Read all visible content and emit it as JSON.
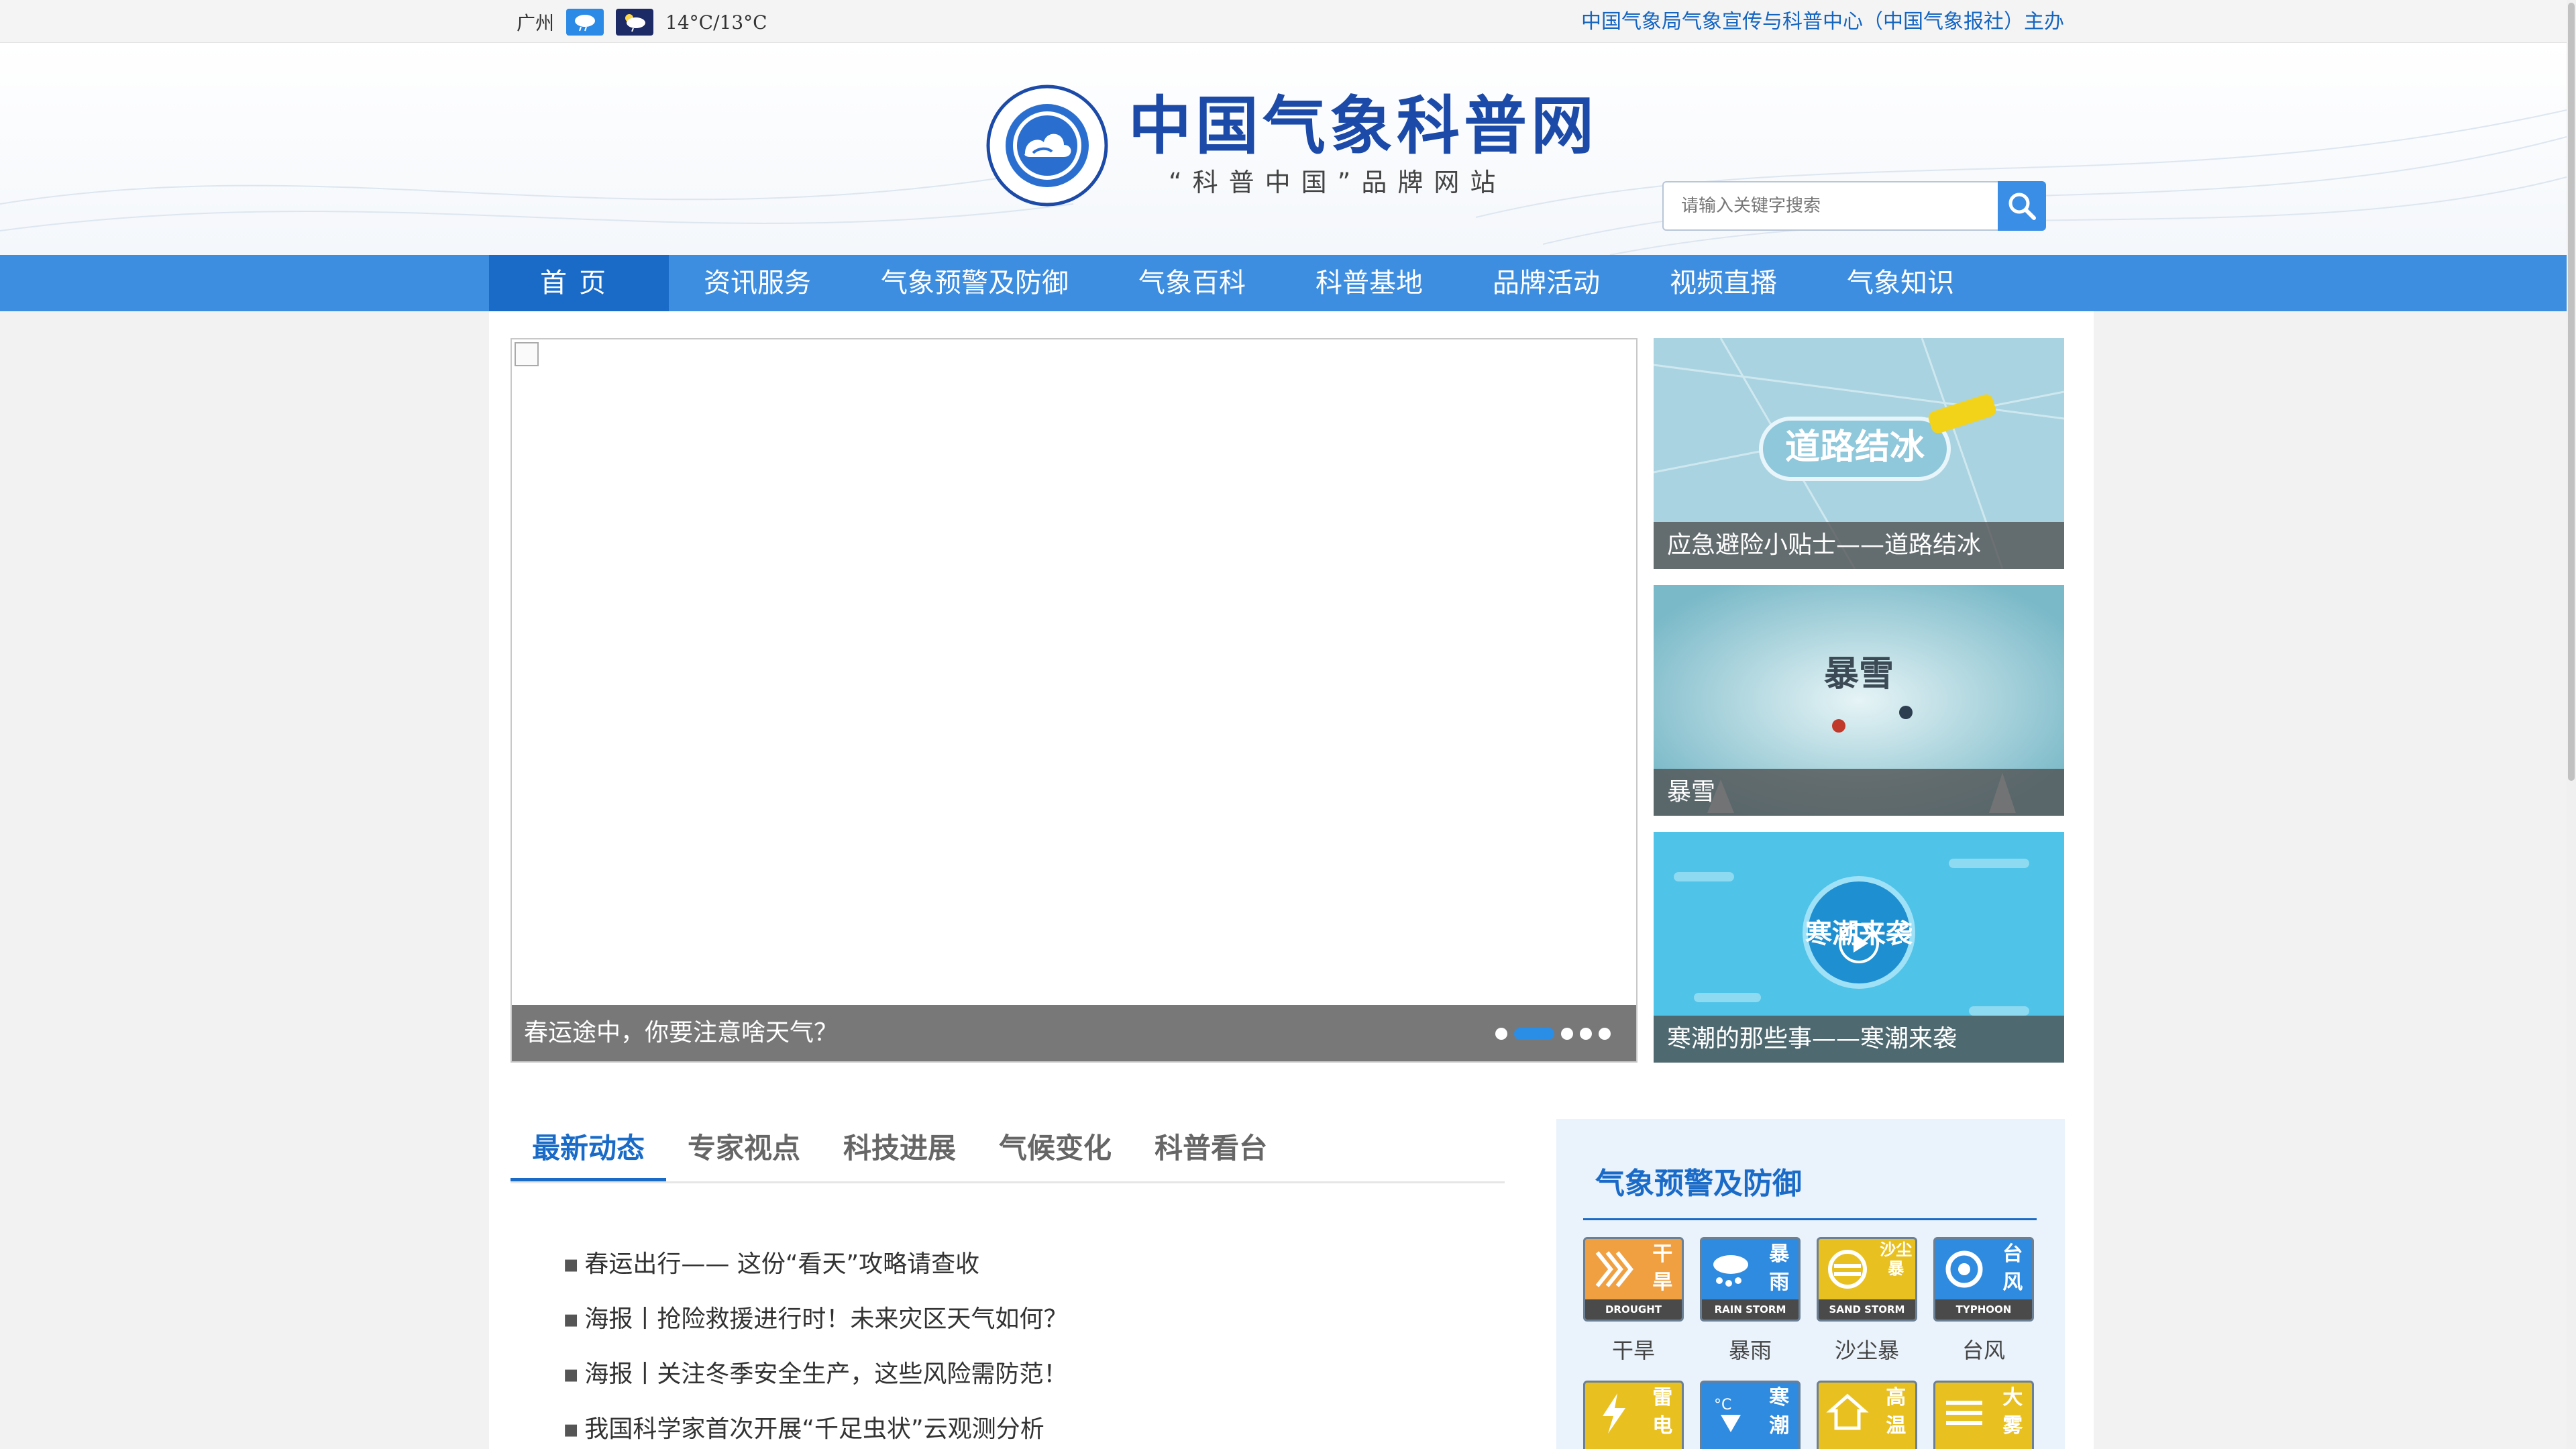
{
  "topbar": {
    "city": "广州",
    "weather_day_icon": "rain-cloud-icon",
    "weather_night_icon": "night-cloud-icon",
    "temperature": "14°C/13°C",
    "host_org": "中国气象局气象宣传与科普中心（中国气象报社）主办"
  },
  "header": {
    "site_name": "中国气象科普网",
    "slogan": "“科普中国”品牌网站",
    "search_placeholder": "请输入关键字搜索"
  },
  "nav": {
    "items": [
      "首页",
      "资讯服务",
      "气象预警及防御",
      "气象百科",
      "科普基地",
      "品牌活动",
      "视频直播",
      "气象知识"
    ],
    "active_index": 0
  },
  "carousel": {
    "caption": "春运途中，你要注意啥天气？",
    "slide_count": 5,
    "active_slide": 1
  },
  "side_videos": [
    {
      "caption": "应急避险小贴士——道路结冰",
      "thumb_text": "道路结冰"
    },
    {
      "caption": "暴雪",
      "thumb_text": "暴雪"
    },
    {
      "caption": "寒潮的那些事——寒潮来袭",
      "thumb_text": "寒潮来袭"
    }
  ],
  "news_tabs": {
    "items": [
      "最新动态",
      "专家视点",
      "科技进展",
      "气候变化",
      "科普看台"
    ],
    "active_index": 0
  },
  "news_list": [
    "春运出行—— 这份“看天”攻略请查收",
    "海报丨抢险救援进行时！未来灾区天气如何？",
    "海报丨关注冬季安全生产，这些风险需防范！",
    "我国科学家首次开展“千足虫状”云观测分析"
  ],
  "warning_panel": {
    "title": "气象预警及防御",
    "items": [
      {
        "label": "干旱",
        "glyph": "干旱",
        "en": "DROUGHT",
        "color": "#f0a040"
      },
      {
        "label": "暴雨",
        "glyph": "暴雨",
        "en": "RAIN STORM",
        "color": "#2f8be0"
      },
      {
        "label": "沙尘暴",
        "glyph": "沙尘暴",
        "en": "SAND STORM",
        "color": "#e8c020"
      },
      {
        "label": "台风",
        "glyph": "台风",
        "en": "TYPHOON",
        "color": "#2f8be0"
      },
      {
        "label": "",
        "glyph": "雷电",
        "en": "",
        "color": "#e8c020"
      },
      {
        "label": "",
        "glyph": "寒潮",
        "en": "",
        "color": "#2f8be0"
      },
      {
        "label": "",
        "glyph": "高温",
        "en": "",
        "color": "#e8c020"
      },
      {
        "label": "",
        "glyph": "大雾",
        "en": "",
        "color": "#e8c020"
      }
    ]
  },
  "colors": {
    "nav_bg": "#3d8de0",
    "nav_active": "#1a6bc8",
    "brand_blue": "#1b4aa8",
    "accent": "#2a8ee6"
  }
}
